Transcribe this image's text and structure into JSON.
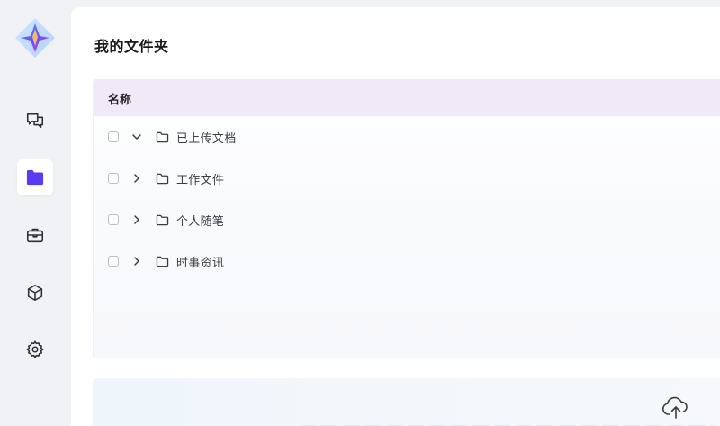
{
  "sidebar": {
    "items": [
      {
        "id": "chat",
        "icon": "chat-icon",
        "active": false
      },
      {
        "id": "folder",
        "icon": "folder-icon",
        "active": true
      },
      {
        "id": "toolbox",
        "icon": "briefcase-icon",
        "active": false
      },
      {
        "id": "cube",
        "icon": "cube-icon",
        "active": false
      },
      {
        "id": "settings",
        "icon": "gear-icon",
        "active": false
      }
    ]
  },
  "page": {
    "title": "我的文件夹"
  },
  "table": {
    "header": "名称",
    "rows": [
      {
        "label": "已上传文档",
        "expanded": true
      },
      {
        "label": "工作文件",
        "expanded": false
      },
      {
        "label": "个人随笔",
        "expanded": false
      },
      {
        "label": "时事资讯",
        "expanded": false
      }
    ]
  },
  "upload": {
    "icon": "cloud-upload-icon"
  },
  "colors": {
    "accent": "#5b3bf0",
    "header_bg": "#efe9f8",
    "sidebar_bg": "#f1f2f5"
  }
}
